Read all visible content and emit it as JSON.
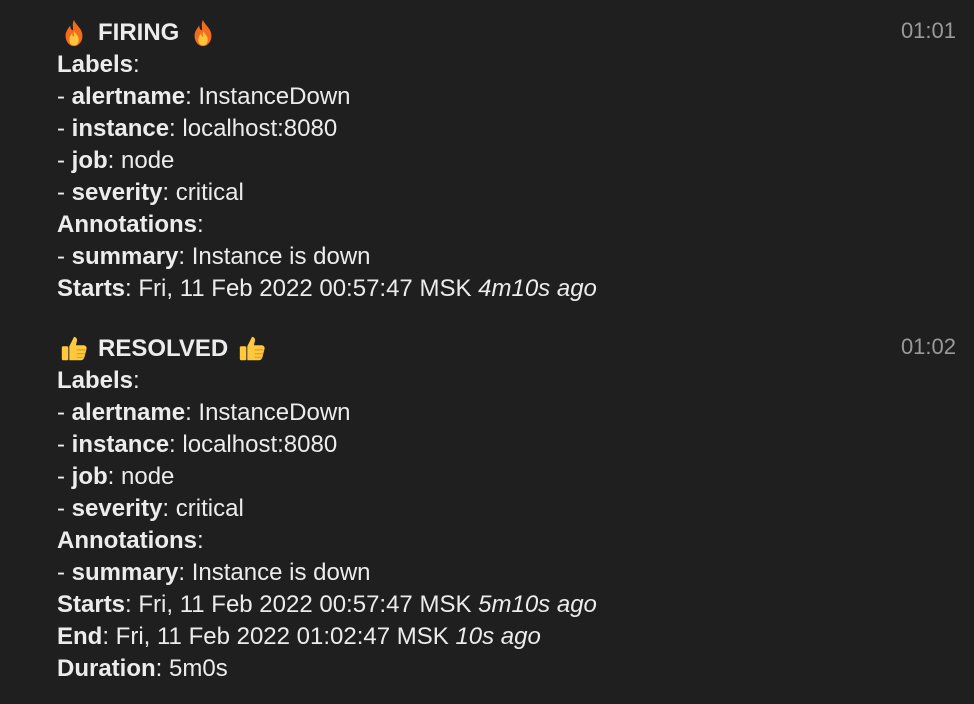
{
  "messages": [
    {
      "title": "FIRING",
      "emoji": "fire-icon",
      "time": "01:01",
      "labels_heading": "Labels",
      "labels": [
        {
          "key": "alertname",
          "value": "InstanceDown"
        },
        {
          "key": "instance",
          "value": "localhost:8080"
        },
        {
          "key": "job",
          "value": "node"
        },
        {
          "key": "severity",
          "value": "critical"
        }
      ],
      "annotations_heading": "Annotations",
      "annotations": [
        {
          "key": "summary",
          "value": "Instance is down"
        }
      ],
      "starts_label": "Starts",
      "starts_value": "Fri, 11 Feb 2022 00:57:47 MSK",
      "starts_ago": "4m10s ago"
    },
    {
      "title": "RESOLVED",
      "emoji": "thumbs-up-icon",
      "time": "01:02",
      "labels_heading": "Labels",
      "labels": [
        {
          "key": "alertname",
          "value": "InstanceDown"
        },
        {
          "key": "instance",
          "value": "localhost:8080"
        },
        {
          "key": "job",
          "value": "node"
        },
        {
          "key": "severity",
          "value": "critical"
        }
      ],
      "annotations_heading": "Annotations",
      "annotations": [
        {
          "key": "summary",
          "value": "Instance is down"
        }
      ],
      "starts_label": "Starts",
      "starts_value": "Fri, 11 Feb 2022 00:57:47 MSK",
      "starts_ago": "5m10s ago",
      "end_label": "End",
      "end_value": "Fri, 11 Feb 2022 01:02:47 MSK",
      "end_ago": "10s ago",
      "duration_label": "Duration",
      "duration_value": "5m0s"
    }
  ],
  "punctuation": {
    "colon": ":",
    "dash": "- "
  },
  "colors": {
    "background": "#1f1f1f",
    "text": "#ececec",
    "timestamp": "#9a9a9a"
  }
}
